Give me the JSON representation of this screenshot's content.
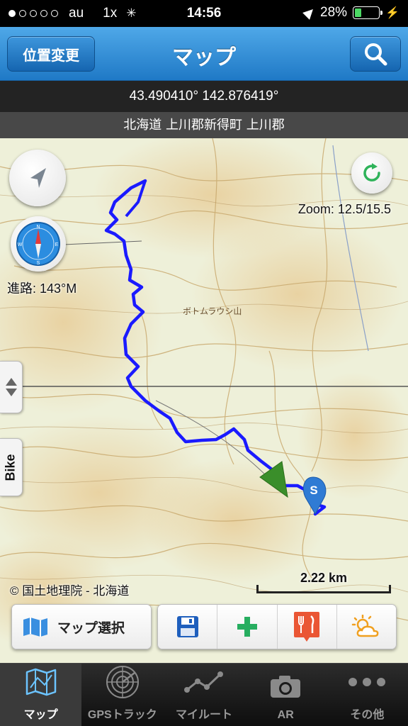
{
  "status_bar": {
    "carrier": "au",
    "network": "1x",
    "time": "14:56",
    "battery_text": "28%",
    "battery_level": 0.28,
    "icons": [
      "signal-dots-icon",
      "activity-spinner-icon",
      "location-arrow-icon",
      "battery-icon",
      "charging-bolt-icon"
    ]
  },
  "nav": {
    "left_button": "位置変更",
    "title": "マップ",
    "right_icon": "search-icon"
  },
  "info": {
    "coordinates": "43.490410° 142.876419°",
    "address": "北海道 上川郡新得町 上川郡"
  },
  "map": {
    "zoom_label": "Zoom: 12.5/15.5",
    "heading_label": "進路: 143°M",
    "side_tab_label": "Bike",
    "copyright": "© 国土地理院 - 北海道",
    "scale_label": "2.22 km",
    "start_marker_label": "S",
    "track_color": "#1a1aff",
    "peak_label": "ボトムラウシ山"
  },
  "toolbar": {
    "map_select_label": "マップ選択",
    "icons": [
      "save-icon",
      "add-icon",
      "restaurant-icon",
      "weather-icon"
    ]
  },
  "tabs": [
    {
      "label": "マップ",
      "icon": "map-icon",
      "active": true
    },
    {
      "label": "GPSトラック",
      "icon": "radar-icon",
      "active": false
    },
    {
      "label": "マイルート",
      "icon": "route-icon",
      "active": false
    },
    {
      "label": "AR",
      "icon": "camera-icon",
      "active": false
    },
    {
      "label": "その他",
      "icon": "more-icon",
      "active": false
    }
  ]
}
